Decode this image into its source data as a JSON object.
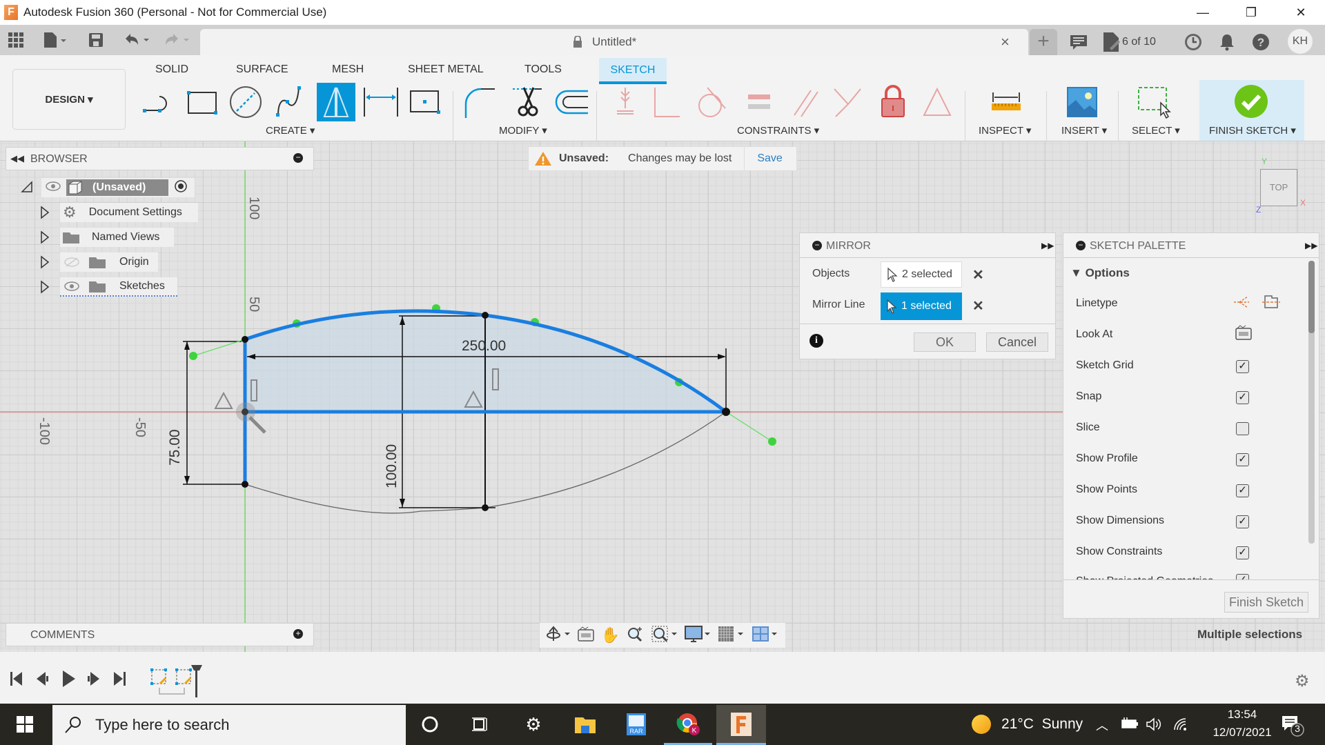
{
  "window": {
    "title": "Autodesk Fusion 360 (Personal - Not for Commercial Use)",
    "logo_letter": "F",
    "minimize": "—",
    "restore": "❐",
    "close": "✕"
  },
  "quick_access": {
    "doc_tab_title": "Untitled*",
    "doc_tab_close": "×",
    "new_tab": "+",
    "job_count": "6 of 10",
    "user_initials": "KH"
  },
  "ribbon": {
    "workspace": "DESIGN ▾",
    "tabs": [
      "SOLID",
      "SURFACE",
      "MESH",
      "SHEET METAL",
      "TOOLS",
      "SKETCH"
    ],
    "active_tab": "SKETCH",
    "groups": {
      "create": "CREATE ▾",
      "modify": "MODIFY ▾",
      "constraints": "CONSTRAINTS ▾",
      "inspect": "INSPECT ▾",
      "insert": "INSERT ▾",
      "select": "SELECT ▾",
      "finish": "FINISH SKETCH ▾"
    },
    "active_tool": "mirror",
    "accent": "#0696d7",
    "finish_color": "#6cc417"
  },
  "browser": {
    "title": "BROWSER",
    "root": "(Unsaved)",
    "items": [
      {
        "label": "Document Settings",
        "icon": "gear-icon"
      },
      {
        "label": "Named Views",
        "icon": "folder-icon"
      },
      {
        "label": "Origin",
        "icon": "folder-icon"
      },
      {
        "label": "Sketches",
        "icon": "folder-icon"
      }
    ]
  },
  "notice": {
    "title": "Unsaved:",
    "message": "Changes may be lost",
    "action": "Save"
  },
  "mirror": {
    "title": "MIRROR",
    "objects_label": "Objects",
    "objects_value": "2 selected",
    "mirror_line_label": "Mirror Line",
    "mirror_line_value": "1 selected",
    "ok": "OK",
    "cancel": "Cancel"
  },
  "palette": {
    "title": "SKETCH PALETTE",
    "section": "Options",
    "rows": [
      {
        "label": "Linetype",
        "type": "icons"
      },
      {
        "label": "Look At",
        "type": "icon"
      },
      {
        "label": "Sketch Grid",
        "checked": true
      },
      {
        "label": "Snap",
        "checked": true
      },
      {
        "label": "Slice",
        "checked": false
      },
      {
        "label": "Show Profile",
        "checked": true
      },
      {
        "label": "Show Points",
        "checked": true
      },
      {
        "label": "Show Dimensions",
        "checked": true
      },
      {
        "label": "Show Constraints",
        "checked": true
      },
      {
        "label": "Show Projected Geometries",
        "checked": true
      }
    ],
    "finish_button": "Finish Sketch",
    "status": "Multiple selections"
  },
  "sketch": {
    "axis_labels": {
      "y_100": "100",
      "y_50": "50",
      "x_neg100": "-100",
      "x_neg50": "-50"
    },
    "dimensions": {
      "width": "250.00",
      "left_height": "75.00",
      "center_height": "100.00"
    },
    "viewcube": {
      "face": "TOP",
      "x": "X",
      "y": "Y",
      "z": "Z"
    }
  },
  "comments": {
    "title": "COMMENTS"
  },
  "taskbar": {
    "search_placeholder": "Type here to search",
    "weather": "21°C  Sunny",
    "time": "13:54",
    "date": "12/07/2021",
    "notifications": "3"
  }
}
